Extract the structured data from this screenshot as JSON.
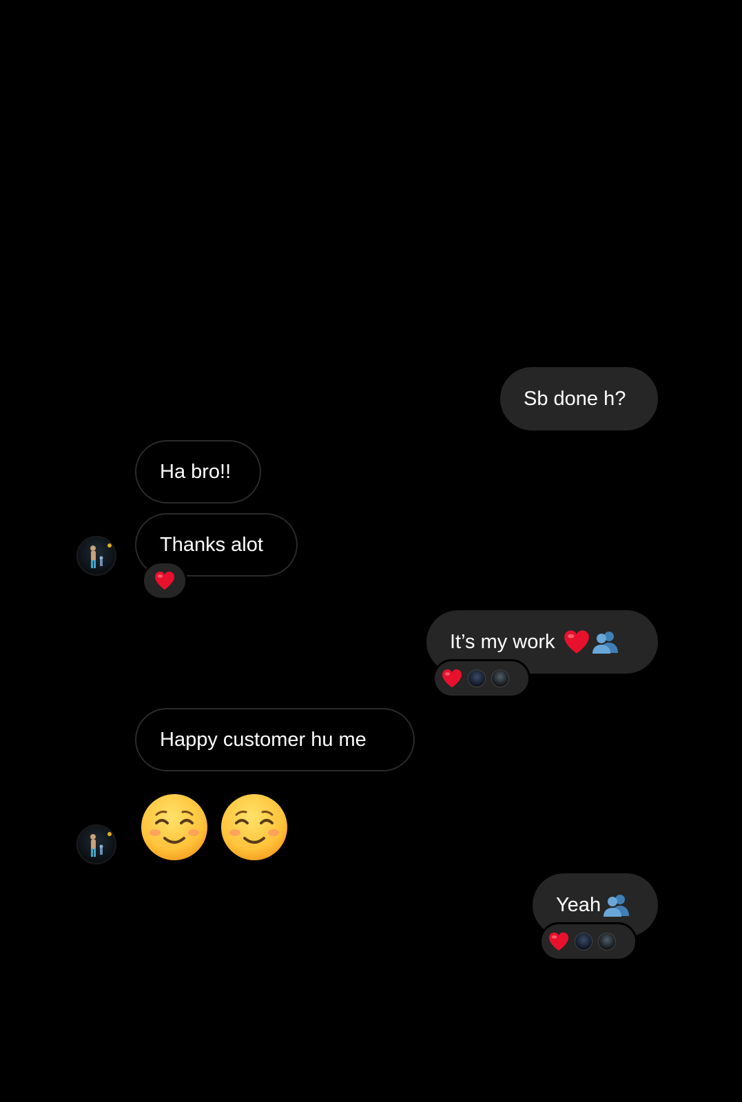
{
  "messages": [
    {
      "sender": "me",
      "text": "Sb done h?"
    },
    {
      "sender": "them",
      "text": "Ha bro!!"
    },
    {
      "sender": "them",
      "text": "Thanks alot",
      "reactions": [
        "heart"
      ]
    },
    {
      "sender": "me",
      "text": "It’s my work",
      "trailing_icons": [
        "red-heart-icon",
        "busts-in-silhouette-icon"
      ],
      "reactions": [
        "heart",
        "avatar",
        "avatar"
      ]
    },
    {
      "sender": "them",
      "text": "Happy customer hu me"
    },
    {
      "sender": "them",
      "emoji": [
        "smiling-face-icon",
        "smiling-face-icon"
      ]
    },
    {
      "sender": "me",
      "text": "Yeah",
      "trailing_icons": [
        "busts-in-silhouette-icon"
      ],
      "reactions": [
        "heart",
        "avatar",
        "avatar"
      ]
    }
  ],
  "colors": {
    "background": "#000000",
    "outgoing_bubble": "#262626",
    "incoming_border": "#2b2b2b",
    "text": "#ffffff",
    "heart": "#e8112d",
    "silhouette": "#4a8fc9",
    "smiley": "#ffc83d"
  }
}
